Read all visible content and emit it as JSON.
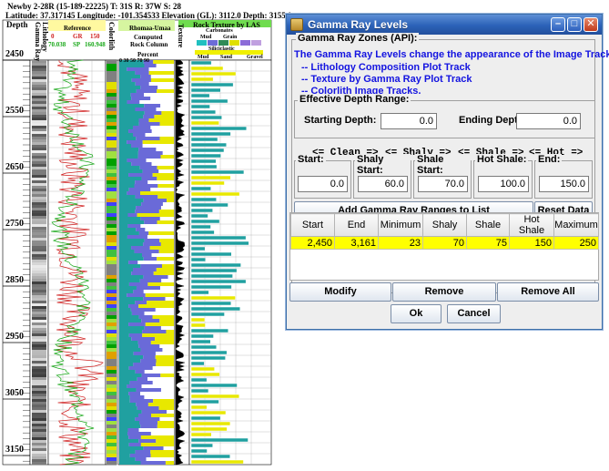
{
  "log_plot": {
    "title_line1": "Newby 2-28R (15-189-22225) T: 31S R: 37W S: 28",
    "title_line2": "Latitude: 37.317145 Longitude: -101.354533 Elevation (GL): 3112.0 Depth: 3155.0",
    "header": {
      "depth": "Depth",
      "gamma_ray": "Gamma Ray",
      "lithology": "Lithology",
      "reference": "Reference",
      "gr_left": "0",
      "gr_mid": "GR",
      "gr_right": "150",
      "sp_left": "70.038",
      "sp_mid": "SP",
      "sp_right": "160.948",
      "colorlith": "Colorlith",
      "illuminate_image": "Rhomaa-Umaa",
      "computed": "Computed",
      "rock_column": "Rock Column",
      "percent": "Percent",
      "pct_ticks": "0  30  50  70  90",
      "texture_track": "Texture",
      "rock_texture": "Rock Texture by LAS",
      "carbonates": "Carbonates",
      "mud": "Mud",
      "grain": "Grain",
      "siliciclastic": "Siliciclastic",
      "sand": "Sand",
      "gravel": "Gravel"
    },
    "depth_ticks": [
      "2450",
      "2550",
      "2650",
      "2750",
      "2850",
      "2950",
      "3050",
      "3150"
    ],
    "colors": {
      "gr_curve": "#d02020",
      "sp_curve": "#18a818",
      "sand": "#e8e800",
      "shale": "#5050c8",
      "carbonate": "#20a0a0",
      "track_bg": "#ffffff",
      "grid": "#9a9a9a"
    }
  },
  "dialog": {
    "window_title": "Gamma Ray Levels",
    "zones_legend": "Gamma Ray Zones (API):",
    "info_line1": "The Gamma Ray Levels change the appearance of the Image Tracks:",
    "info_line2": "-- Lithology Composition Plot Track",
    "info_line3": "-- Texture by Gamma Ray Plot Track",
    "info_line4": "-- Colorlith Image Tracks.",
    "range_legend": "Effective Depth Range:",
    "starting_depth_label": "Starting Depth:",
    "starting_depth_value": "0.0",
    "ending_depth_label": "Ending Depth:",
    "ending_depth_value": "0.0",
    "arrow_labels": [
      "<= Clean =>",
      "<= Shaly =>",
      "<= Shale =>",
      "<= Hot =>"
    ],
    "start_legend": "Start:",
    "start_value": "0.0",
    "shaly_start_legend": "Shaly Start:",
    "shaly_start_value": "60.0",
    "shale_start_legend": "Shale Start:",
    "shale_start_value": "70.0",
    "hot_shale_legend": "Hot Shale:",
    "hot_shale_value": "100.0",
    "end_legend": "End:",
    "end_value": "150.0",
    "add_button": "Add Gamma Ray Ranges to List",
    "reset_button": "Reset Data",
    "table": {
      "columns": [
        "Start",
        "End",
        "Minimum",
        "Shaly",
        "Shale",
        "Hot Shale",
        "Maximum"
      ],
      "rows": [
        [
          "2,450",
          "3,161",
          "23",
          "70",
          "75",
          "150",
          "250"
        ]
      ]
    },
    "modify_button": "Modify",
    "remove_button": "Remove",
    "remove_all_button": "Remove All",
    "ok_button": "Ok",
    "cancel_button": "Cancel"
  }
}
